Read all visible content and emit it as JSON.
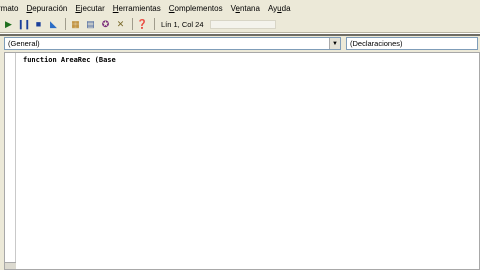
{
  "menubar": {
    "items": [
      {
        "label": "rmato",
        "ul": ""
      },
      {
        "pre": "",
        "ul": "D",
        "post": "epuración"
      },
      {
        "pre": "",
        "ul": "E",
        "post": "jecutar"
      },
      {
        "pre": "",
        "ul": "H",
        "post": "erramientas"
      },
      {
        "pre": "",
        "ul": "C",
        "post": "omplementos"
      },
      {
        "pre": "V",
        "ul": "e",
        "post": "ntana"
      },
      {
        "pre": "Ay",
        "ul": "u",
        "post": "da"
      }
    ]
  },
  "toolbar": {
    "position_text": "Lín 1, Col 24",
    "icons": [
      "play-icon",
      "pause-icon",
      "stop-icon",
      "design-mode-icon",
      "project-explorer-icon",
      "properties-icon",
      "object-browser-icon",
      "toolbox-icon",
      "help-icon"
    ]
  },
  "code_window": {
    "object_combo": "(General)",
    "procedure_combo": "(Declaraciones)",
    "code_lines": [
      "function AreaRec (Base"
    ]
  }
}
